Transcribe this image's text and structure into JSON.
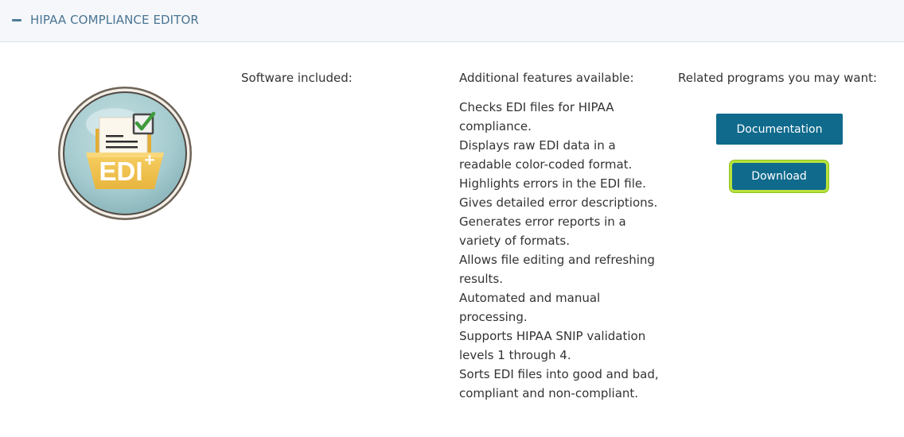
{
  "header": {
    "title": "HIPAA COMPLIANCE EDITOR",
    "collapse_icon": "minus-icon"
  },
  "logo": {
    "text": "EDI",
    "superscript": "+",
    "icon": "folder-document-checkmark-icon",
    "colors": {
      "circle": "#a9cdd0",
      "folder": "#f0c04c",
      "check": "#3f9a3b"
    }
  },
  "columns": {
    "software_title": "Software included:",
    "features_title": "Additional features available:",
    "related_title": "Related programs you may want:"
  },
  "features": [
    "Checks EDI files for HIPAA compliance.",
    "Displays raw EDI data in a readable color-coded format.",
    "Highlights errors in the EDI file.",
    "Gives detailed error descriptions.",
    "Generates error reports in a variety of formats.",
    "Allows file editing and refreshing results.",
    "Automated and manual processing.",
    "Supports HIPAA SNIP validation levels 1 through 4.",
    "Sorts EDI files into good and bad, compliant and non-compliant."
  ],
  "buttons": {
    "documentation": "Documentation",
    "download": "Download"
  },
  "colors": {
    "header_bg": "#f5f7fa",
    "header_text": "#4a7593",
    "button_bg": "#0f6a8c",
    "focus_ring": "#b8e23b"
  }
}
